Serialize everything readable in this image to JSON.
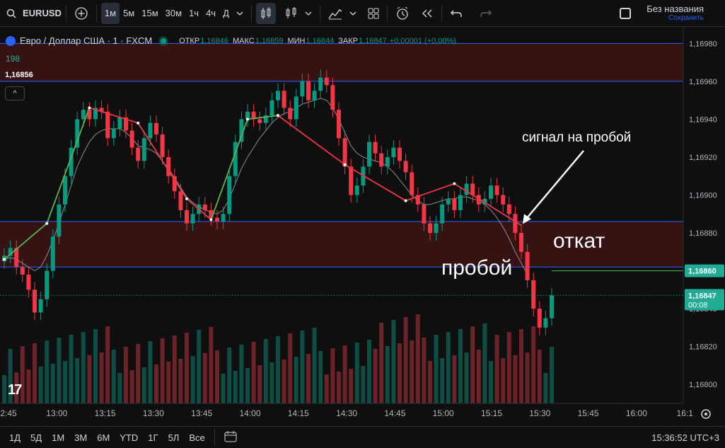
{
  "toolbar": {
    "symbol": "EURUSD",
    "intervals": [
      "1м",
      "5м",
      "15м",
      "30м",
      "1ч",
      "4ч",
      "Д"
    ],
    "active_interval": "1м",
    "layout_title": "Без названия",
    "layout_sub": "Сохранить"
  },
  "legend": {
    "instrument": "Евро / Доллар США · 1 · FXCM",
    "open_label": "ОТКР",
    "open": "1,16846",
    "high_label": "МАКС",
    "high": "1,16859",
    "low_label": "МИН",
    "low": "1,16844",
    "close_label": "ЗАКР",
    "close": "1,16847",
    "change": "+0,00001 (+0,00%)",
    "volume": "198",
    "cursor_price": "1,16856",
    "collapse_glyph": "^"
  },
  "bottom": {
    "ranges": [
      "1Д",
      "5Д",
      "1М",
      "3М",
      "6М",
      "YTD",
      "1Г",
      "5Л",
      "Все"
    ],
    "clock": "15:36:52 UTC+3"
  },
  "colors": {
    "up": "#089981",
    "down": "#f23645",
    "bg": "#0f0f0f",
    "level": "#2962ff",
    "zone": "#3a1414"
  },
  "chart_data": {
    "type": "candlestick",
    "title": "Евро / Доллар США · 1 · FXCM",
    "ylim": [
      1.1679,
      1.16985
    ],
    "y_ticks": [
      "1,16980",
      "1,16960",
      "1,16940",
      "1,16920",
      "1,16900",
      "1,16880",
      "1,16860",
      "1,16840",
      "1,16820",
      "1,16800"
    ],
    "x_ticks": [
      "2:45",
      "13:00",
      "13:15",
      "13:30",
      "13:45",
      "14:00",
      "14:15",
      "14:30",
      "14:45",
      "15:00",
      "15:15",
      "15:30",
      "15:45",
      "16:00",
      "16:1"
    ],
    "last_price": "1,16847",
    "last_price_timer": "00:08",
    "marker_price": "1,16860",
    "annotations": [
      "сигнал на пробой",
      "пробой",
      "откат"
    ],
    "candles_close": [
      1.16868,
      1.16872,
      1.16862,
      1.16858,
      1.1685,
      1.16838,
      1.16845,
      1.1686,
      1.16878,
      1.16895,
      1.1691,
      1.16925,
      1.1694,
      1.16945,
      1.1694,
      1.16946,
      1.16944,
      1.1693,
      1.16935,
      1.16941,
      1.16934,
      1.16925,
      1.16918,
      1.1693,
      1.16938,
      1.16932,
      1.1692,
      1.1691,
      1.16902,
      1.16892,
      1.16885,
      1.1689,
      1.16895,
      1.16892,
      1.16888,
      1.16886,
      1.1689,
      1.1691,
      1.16928,
      1.1694,
      1.16944,
      1.1694,
      1.16938,
      1.16942,
      1.1695,
      1.16955,
      1.16946,
      1.1694,
      1.16952,
      1.1696,
      1.1695,
      1.16955,
      1.16962,
      1.16958,
      1.16945,
      1.1693,
      1.16915,
      1.169,
      1.16905,
      1.16915,
      1.16928,
      1.16922,
      1.16915,
      1.1692,
      1.16925,
      1.16918,
      1.16912,
      1.169,
      1.16895,
      1.16885,
      1.1688,
      1.16885,
      1.16895,
      1.16898,
      1.16892,
      1.169,
      1.16906,
      1.169,
      1.16895,
      1.16898,
      1.16905,
      1.169,
      1.16895,
      1.1689,
      1.1688,
      1.1687,
      1.16855,
      1.1684,
      1.1683,
      1.16835,
      1.16847
    ],
    "ma_close": [
      1.16866,
      1.16867,
      1.16866,
      1.16864,
      1.16862,
      1.1686,
      1.16862,
      1.16868,
      1.16876,
      1.16885,
      1.16895,
      1.16905,
      1.16915,
      1.16922,
      1.16928,
      1.16932,
      1.16934,
      1.16935,
      1.16935,
      1.16935,
      1.16933,
      1.1693,
      1.16926,
      1.16925,
      1.16924,
      1.16922,
      1.16918,
      1.16914,
      1.16909,
      1.16904,
      1.16899,
      1.16896,
      1.16894,
      1.16892,
      1.16891,
      1.1689,
      1.16892,
      1.16898,
      1.16906,
      1.16914,
      1.1692,
      1.16925,
      1.1693,
      1.16934,
      1.16938,
      1.16941,
      1.16943,
      1.16944,
      1.16946,
      1.16948,
      1.16949,
      1.1695,
      1.16951,
      1.1695,
      1.16946,
      1.1694,
      1.16933,
      1.16926,
      1.16922,
      1.1692,
      1.16919,
      1.16918,
      1.16917,
      1.16915,
      1.16912,
      1.16908,
      1.16904,
      1.169,
      1.16897,
      1.16895,
      1.16895,
      1.16896,
      1.16897,
      1.16898,
      1.16898,
      1.16899,
      1.16899,
      1.16898,
      1.16897,
      1.16895,
      1.16892,
      1.16888,
      1.16883,
      1.16877,
      1.1687,
      1.16864,
      1.16858
    ],
    "levels": [
      1.1698,
      1.1696,
      1.16886,
      1.16862
    ],
    "zones": [
      [
        1.1696,
        1.1698
      ],
      [
        1.16862,
        1.16886
      ]
    ]
  }
}
